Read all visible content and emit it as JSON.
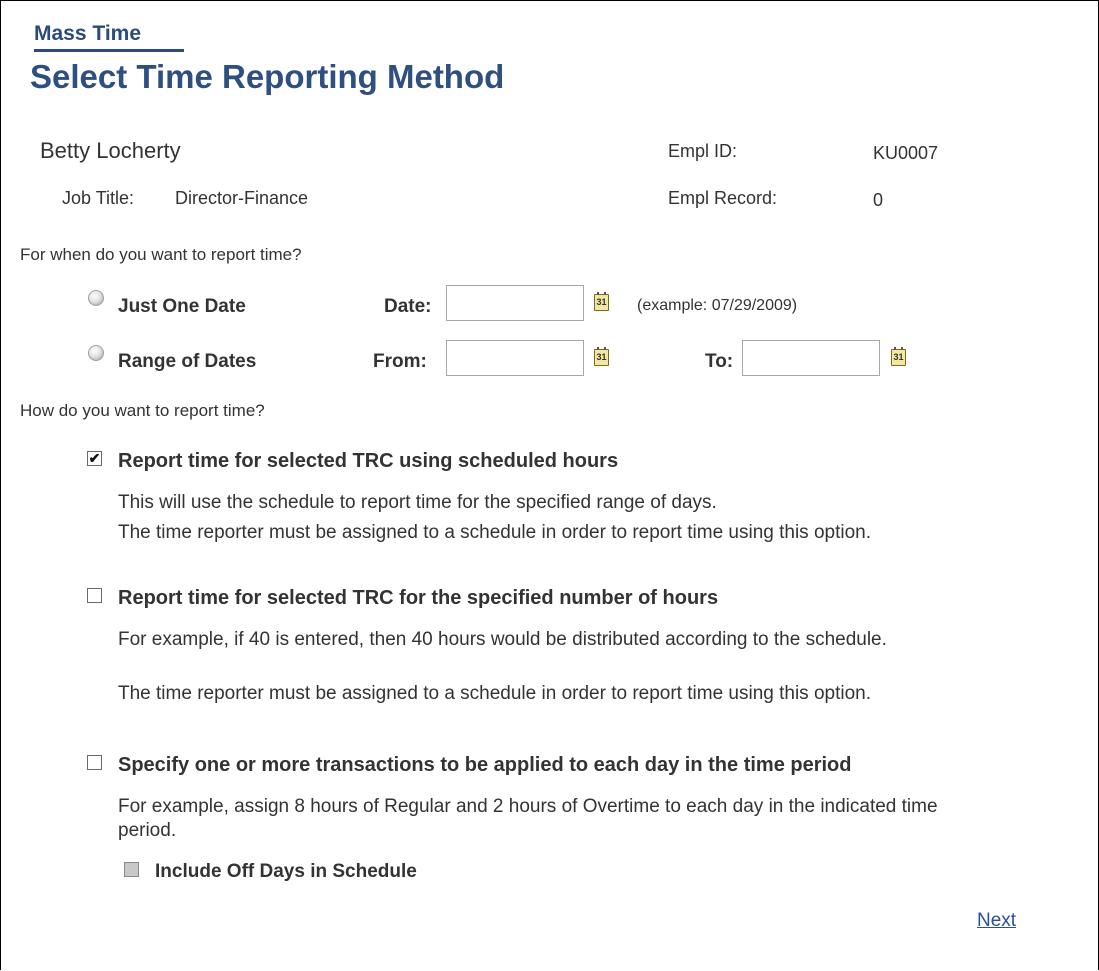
{
  "header": {
    "breadcrumb": "Mass Time",
    "title": "Select Time Reporting Method"
  },
  "employee": {
    "name": "Betty Locherty",
    "job_title_label": "Job Title:",
    "job_title": "Director-Finance",
    "empl_id_label": "Empl ID:",
    "empl_id": "KU0007",
    "empl_record_label": "Empl Record:",
    "empl_record": "0"
  },
  "when": {
    "question": "For when do you want to report time?",
    "just_one_date": {
      "label": "Just One Date",
      "selected": false,
      "date_label": "Date:",
      "date_value": "",
      "example": "(example: 07/29/2009)"
    },
    "range_of_dates": {
      "label": "Range of Dates",
      "selected": false,
      "from_label": "From:",
      "from_value": "",
      "to_label": "To:",
      "to_value": ""
    },
    "calendar_glyph": "31"
  },
  "how": {
    "question": "How do you want to report time?",
    "options": [
      {
        "label": "Report time for selected TRC using scheduled hours",
        "checked": true,
        "description": [
          "This will use the schedule to report time for the specified range of days.",
          "The time reporter must be assigned to a schedule in order to report time using this option."
        ]
      },
      {
        "label": "Report time for selected TRC for the specified number of hours",
        "checked": false,
        "description": [
          "For example, if 40 is entered, then 40 hours would be distributed according to the schedule.",
          "The time reporter must be assigned to a schedule in order to report time using this option."
        ]
      },
      {
        "label": "Specify one or more transactions to be applied to each day in the time period",
        "checked": false,
        "description": [
          "For example, assign 8 hours of Regular and 2 hours of Overtime to each day in the indicated time period."
        ]
      }
    ],
    "include_off_days": {
      "label": "Include Off Days in Schedule",
      "checked": false,
      "disabled": true
    }
  },
  "footer": {
    "next_label": "Next"
  },
  "colors": {
    "title_blue": "#2f4f80",
    "link_blue": "#2b4f9c",
    "calendar_yellow": "#f4e7a1"
  },
  "icons": {
    "calendar": "calendar-icon",
    "checkmark": "checkmark-icon"
  }
}
